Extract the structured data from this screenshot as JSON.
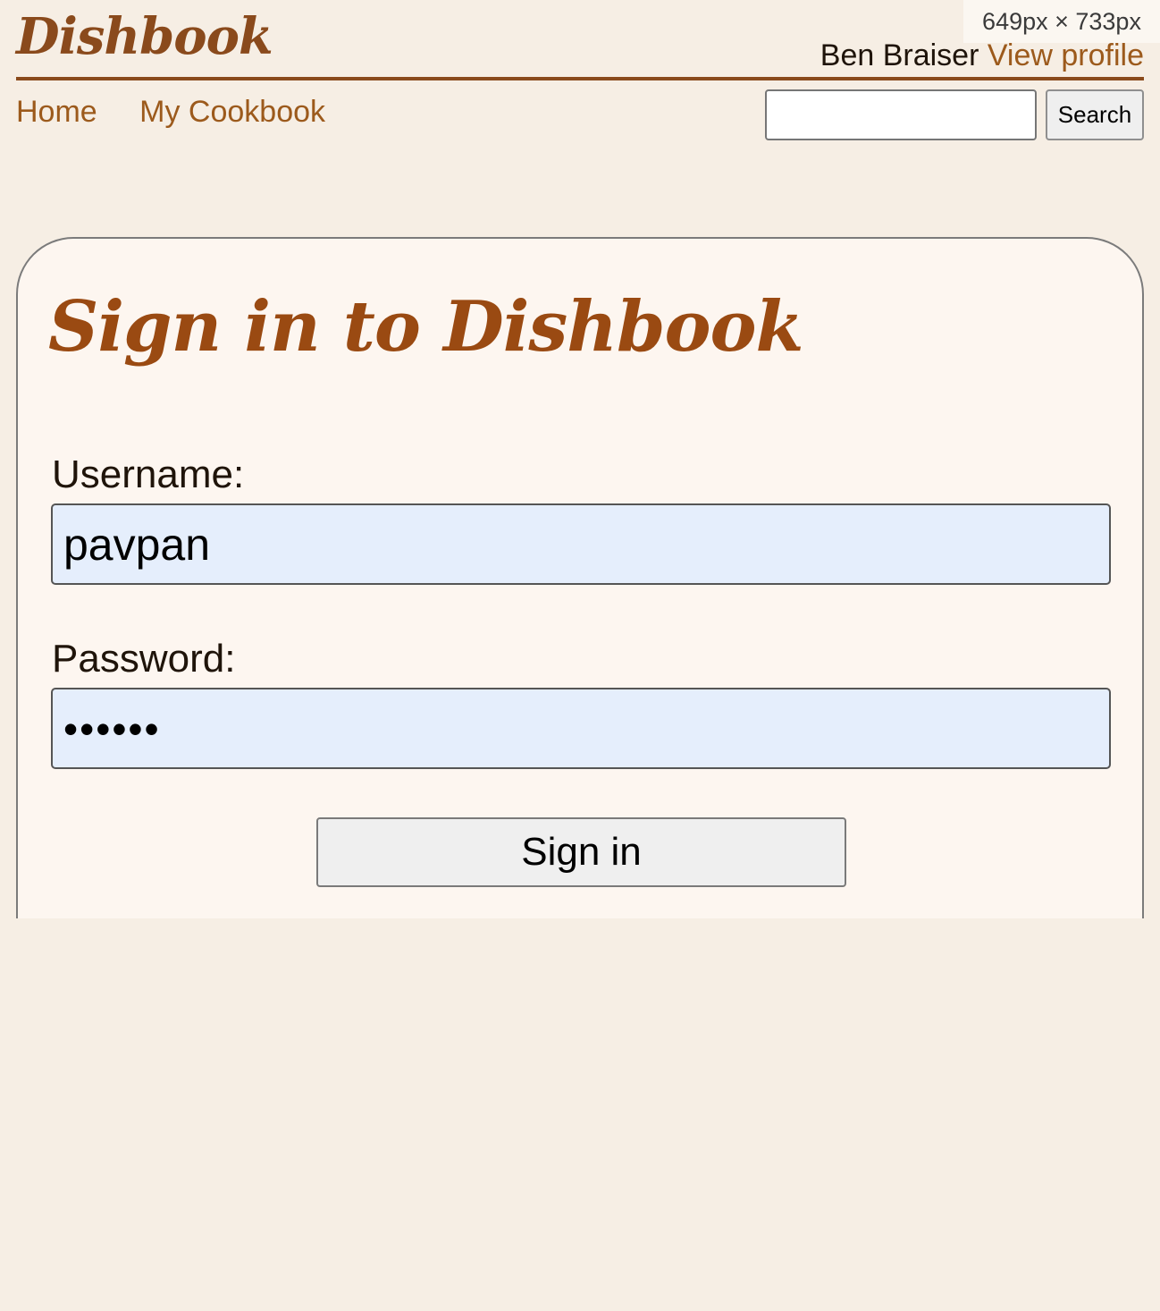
{
  "viewport_overlay": {
    "text": "649px × 733px"
  },
  "header": {
    "logo": "Dishbook",
    "user_name": "Ben Braiser",
    "profile_link": "View profile"
  },
  "nav": {
    "items": [
      {
        "label": "Home"
      },
      {
        "label": "My Cookbook"
      }
    ]
  },
  "search": {
    "value": "",
    "button_label": "Search"
  },
  "signin": {
    "title": "Sign in to Dishbook",
    "username_label": "Username:",
    "username_value": "pavpan",
    "password_label": "Password:",
    "password_value": "••••••",
    "submit_label": "Sign in"
  },
  "colors": {
    "page_background": "#f6eee4",
    "card_background": "#fdf6f0",
    "brand_brown": "#8a4a1c",
    "link_color": "#9c5a1c",
    "autofill_blue": "#e5eefc"
  }
}
